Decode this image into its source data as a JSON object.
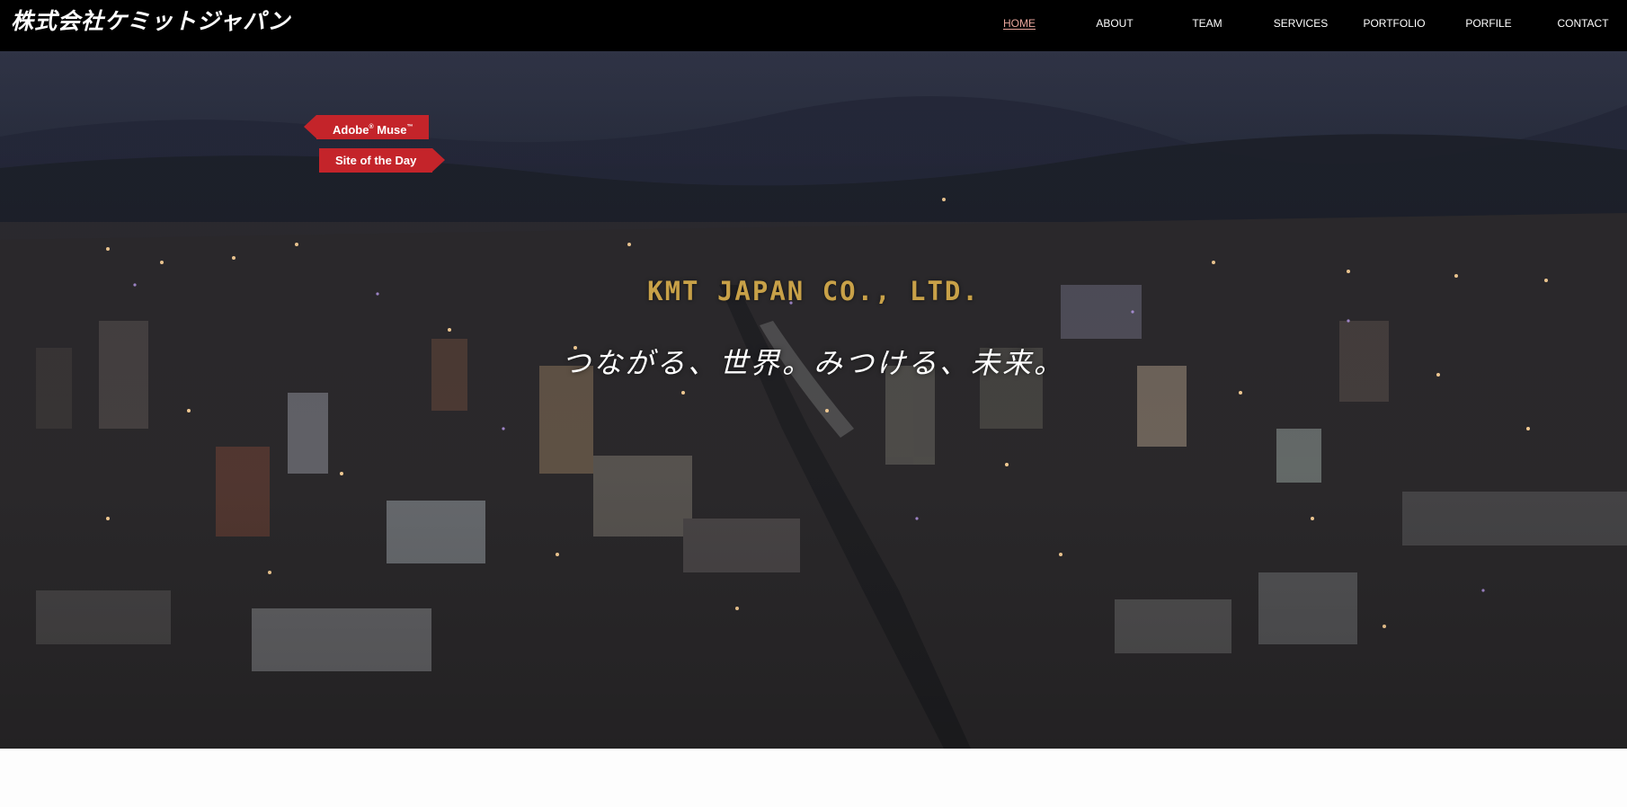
{
  "header": {
    "logo_text": "株式会社ケミットジャパン",
    "nav": [
      {
        "label": "HOME",
        "active": true
      },
      {
        "label": "ABOUT",
        "active": false
      },
      {
        "label": "TEAM",
        "active": false
      },
      {
        "label": "SERVICES",
        "active": false
      },
      {
        "label": "PORTFOLIO",
        "active": false
      },
      {
        "label": "PORFILE",
        "active": false
      },
      {
        "label": "CONTACT",
        "active": false
      }
    ],
    "active_color": "#e7a49b"
  },
  "hero": {
    "company_name": "KMT JAPAN CO., LTD.",
    "tagline": "つながる、世界。みつける、未来。",
    "award": {
      "line1": "Adobe",
      "line1b": "Muse",
      "line2": "Site of the Day"
    },
    "headline_color": "#c8a148",
    "ribbon_color": "#c4242a"
  }
}
